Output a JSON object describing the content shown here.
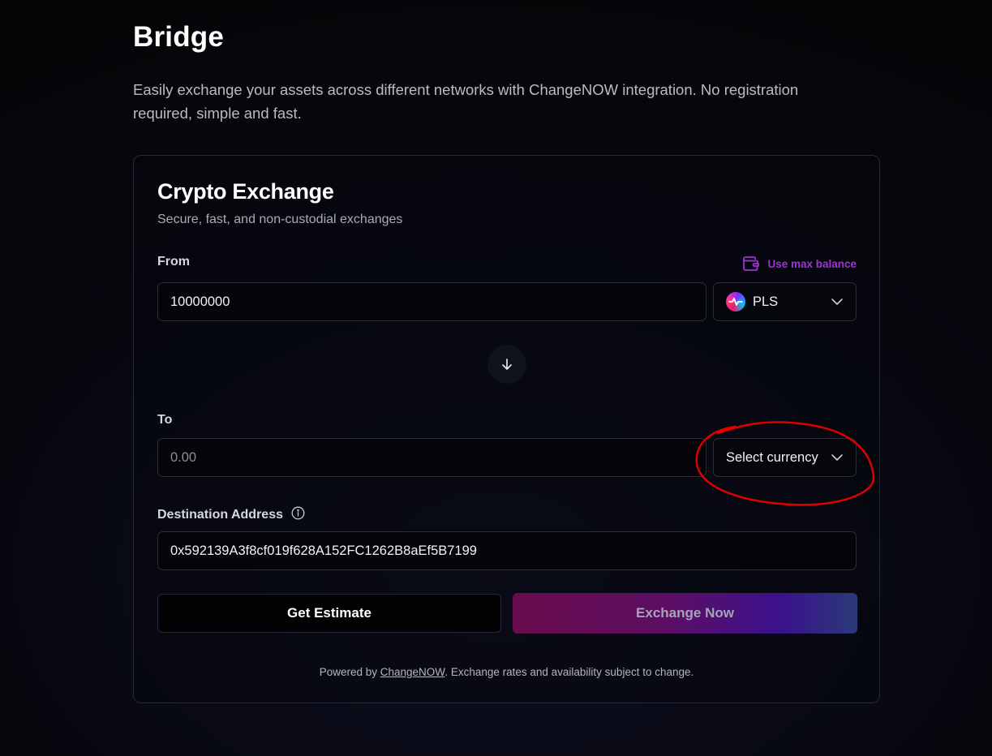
{
  "page": {
    "title": "Bridge",
    "description": "Easily exchange your assets across different networks with ChangeNOW integration. No registration required, simple and fast."
  },
  "card": {
    "title": "Crypto Exchange",
    "subtitle": "Secure, fast, and non-custodial exchanges"
  },
  "from": {
    "label": "From",
    "max_balance_label": "Use max balance",
    "amount": "10000000",
    "currency": "PLS",
    "currency_icon": "pulsechain-logo-icon"
  },
  "swap": {
    "icon": "arrow-down-icon"
  },
  "to": {
    "label": "To",
    "amount_placeholder": "0.00",
    "currency_placeholder": "Select currency"
  },
  "destination": {
    "label": "Destination Address",
    "value": "0x592139A3f8cf019f628A152FC1262B8aEf5B7199"
  },
  "actions": {
    "estimate_label": "Get Estimate",
    "exchange_label": "Exchange Now"
  },
  "footer": {
    "prefix": "Powered by ",
    "link_text": "ChangeNOW",
    "suffix": ". Exchange rates and availability subject to change."
  },
  "colors": {
    "accent_purple": "#a033d6",
    "annotation_red": "#e00000"
  }
}
